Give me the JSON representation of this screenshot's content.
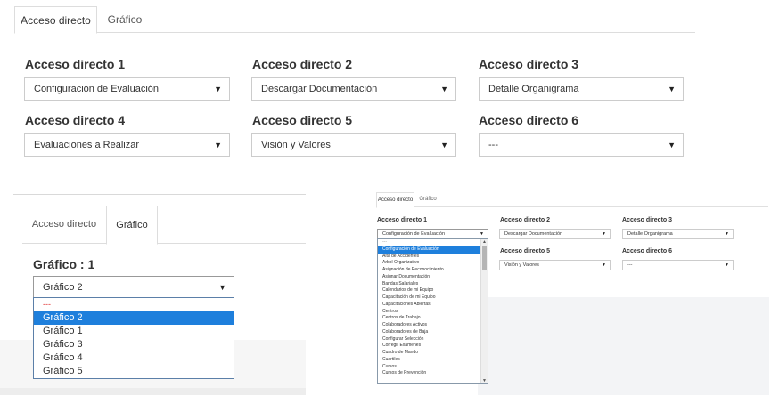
{
  "caret_glyph": "▼",
  "scroll_up_glyph": "▲",
  "panel1": {
    "tabs": [
      {
        "label": "Acceso directo",
        "active": true
      },
      {
        "label": "Gráfico",
        "active": false
      }
    ],
    "shortcuts": [
      {
        "label": "Acceso directo 1",
        "value": "Configuración de Evaluación"
      },
      {
        "label": "Acceso directo 2",
        "value": "Descargar Documentación"
      },
      {
        "label": "Acceso directo 3",
        "value": "Detalle Organigrama"
      },
      {
        "label": "Acceso directo 4",
        "value": "Evaluaciones a Realizar"
      },
      {
        "label": "Acceso directo 5",
        "value": "Visión y Valores"
      },
      {
        "label": "Acceso directo 6",
        "value": "---"
      }
    ]
  },
  "panel2": {
    "tabs": [
      {
        "label": "Acceso directo",
        "active": false
      },
      {
        "label": "Gráfico",
        "active": true
      }
    ],
    "chart_label": "Gráfico : 1",
    "chart_select_value": "Gráfico 2",
    "dropdown_options": [
      "---",
      "Gráfico 2",
      "Gráfico 1",
      "Gráfico 3",
      "Gráfico 4",
      "Gráfico 5"
    ],
    "selected_index": 1
  },
  "panel3": {
    "tabs": [
      {
        "label": "Acceso directo",
        "active": true
      },
      {
        "label": "Gráfico",
        "active": false
      }
    ],
    "shortcuts": [
      {
        "label": "Acceso directo 1",
        "value": ""
      },
      {
        "label": "Acceso directo 2",
        "value": "Descargar Documentación"
      },
      {
        "label": "Acceso directo 3",
        "value": "Detalle Organigrama"
      },
      {
        "label": "Acceso directo 5",
        "value": "Visión y Valores"
      },
      {
        "label": "Acceso directo 6",
        "value": "---"
      }
    ],
    "select1_value": "Configuración de Evaluación",
    "dropdown_options": [
      "---",
      "Configuración de Evaluación",
      "Alta de Accidentes",
      "Árbol Organizativo",
      "Asignación de Reconocimiento",
      "Asignar Documentación",
      "Bandas Salariales",
      "Calendarios de mi Equipo",
      "Capacitación de mi Equipo",
      "Capacitaciones Abiertas",
      "Centros",
      "Centros de Trabajo",
      "Colaboradores Activos",
      "Colaboradores de Baja",
      "Configurar Selección",
      "Corregir Exámenes",
      "Cuadro de Mando",
      "Cuartiles",
      "Cursos",
      "Cursos de Prevención"
    ],
    "selected_index": 1
  }
}
